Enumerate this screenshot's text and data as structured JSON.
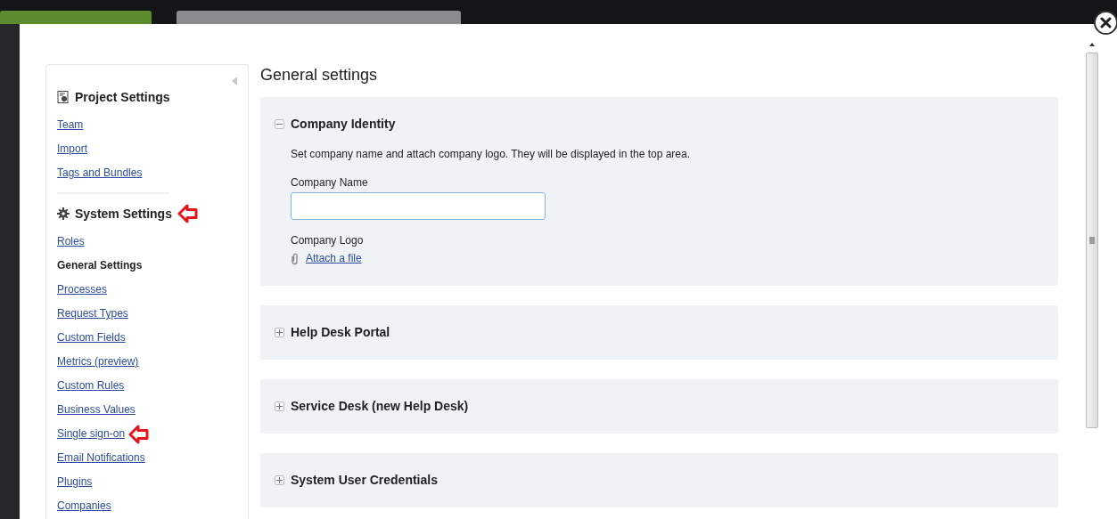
{
  "sidebar": {
    "groups": [
      {
        "title": "Project Settings",
        "annotated": false,
        "items": [
          {
            "label": "Team",
            "selected": false
          },
          {
            "label": "Import",
            "selected": false
          },
          {
            "label": "Tags and Bundles",
            "selected": false
          }
        ]
      },
      {
        "title": "System Settings",
        "annotated": true,
        "items": [
          {
            "label": "Roles",
            "selected": false,
            "annotated": false
          },
          {
            "label": "General Settings",
            "selected": true,
            "annotated": false
          },
          {
            "label": "Processes",
            "selected": false,
            "annotated": false
          },
          {
            "label": "Request Types",
            "selected": false,
            "annotated": false
          },
          {
            "label": "Custom Fields",
            "selected": false,
            "annotated": false
          },
          {
            "label": "Metrics (preview)",
            "selected": false,
            "annotated": false
          },
          {
            "label": "Custom Rules",
            "selected": false,
            "annotated": false
          },
          {
            "label": "Business Values",
            "selected": false,
            "annotated": false
          },
          {
            "label": "Single sign-on",
            "selected": false,
            "annotated": true
          },
          {
            "label": "Email Notifications",
            "selected": false,
            "annotated": false
          },
          {
            "label": "Plugins",
            "selected": false,
            "annotated": false
          },
          {
            "label": "Companies",
            "selected": false,
            "annotated": false
          }
        ]
      }
    ]
  },
  "main": {
    "title": "General settings",
    "sections": [
      {
        "title": "Company Identity",
        "expanded": true,
        "description": "Set company name and attach company logo. They will be displayed in the top area.",
        "fields": [
          {
            "kind": "text",
            "label": "Company Name"
          },
          {
            "kind": "file",
            "label": "Company Logo",
            "link": "Attach a file"
          }
        ]
      },
      {
        "title": "Help Desk Portal",
        "expanded": false
      },
      {
        "title": "Service Desk (new Help Desk)",
        "expanded": false
      },
      {
        "title": "System User Credentials",
        "expanded": false
      }
    ]
  }
}
